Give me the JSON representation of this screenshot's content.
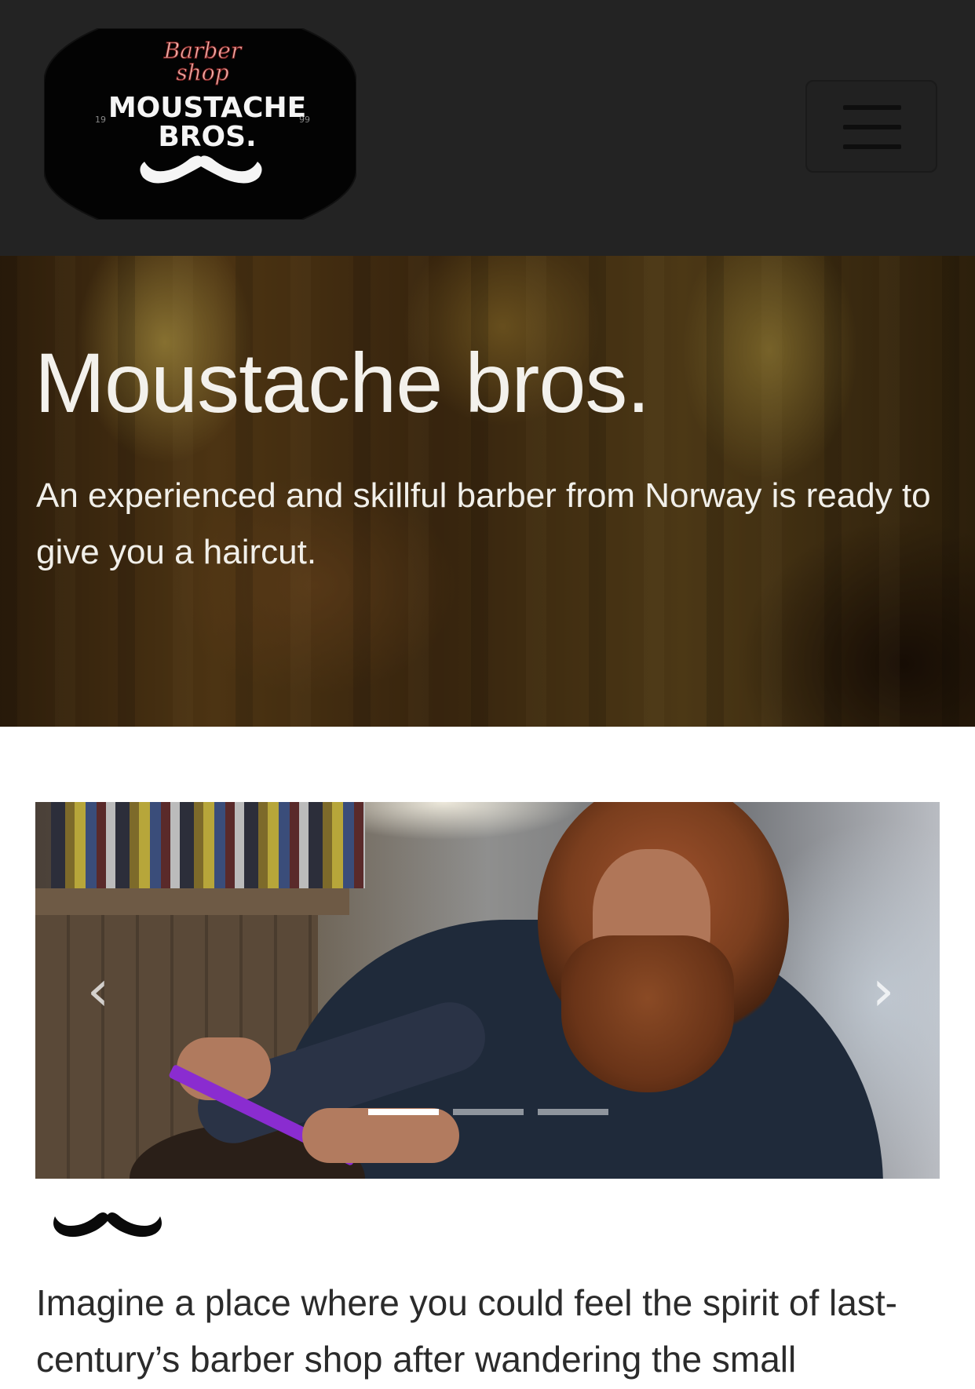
{
  "navbar": {
    "logo": {
      "script_line1": "Barber",
      "script_line2": "shop",
      "line1": "MOUSTACHE",
      "line2": "BROS.",
      "year_left": "19",
      "year_right": "99"
    },
    "menu_icon": "hamburger-icon"
  },
  "hero": {
    "title": "Moustache bros.",
    "subtitle": "An experienced and skillful barber from Norway is ready to give you a haircut."
  },
  "carousel": {
    "prev_icon": "chevron-left-icon",
    "next_icon": "chevron-right-icon",
    "prev_glyph": "‹",
    "next_glyph": "›",
    "slide_count": 3,
    "active_index": 0
  },
  "content": {
    "icon": "moustache-icon",
    "intro_text": "Imagine a place where you could feel the spirit of last-century’s barber shop after wandering the small"
  },
  "colors": {
    "navbar_bg": "#232323",
    "hero_text": "#f3f1ec",
    "body_text": "#2b2b2b"
  }
}
